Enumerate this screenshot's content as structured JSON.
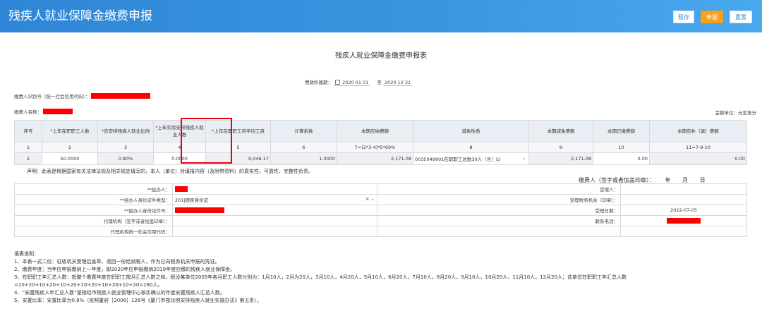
{
  "header": {
    "title": "残疾人就业保障金缴费申报",
    "buttons": {
      "save": "暂存",
      "submit": "申报",
      "reset": "重置"
    }
  },
  "form": {
    "title": "残疾人就业保障金缴费申报表",
    "period_label": "费款所属期：",
    "period_start": "2020 01 01",
    "period_to": "至",
    "period_end": "2020 12 31",
    "payer_id_label": "缴费人识别号（统一社会信用代码）：",
    "payer_name_label": "缴费人名称：",
    "unit_label": "金额单位：元至角分"
  },
  "table": {
    "headers": [
      {
        "star": "",
        "text": "序号"
      },
      {
        "star": "*",
        "text": "上年在职职工人数"
      },
      {
        "star": "*",
        "text": "应安排残疾人就业比例"
      },
      {
        "star": "*",
        "text": "上年实际安排残疾人就业人数"
      },
      {
        "star": "*",
        "text": "上年在职职工月平均工资"
      },
      {
        "star": "",
        "text": "计算系数"
      },
      {
        "star": "",
        "text": "本期应纳费额"
      },
      {
        "star": "",
        "text": "减免性质"
      },
      {
        "star": "",
        "text": "本期减免费额"
      },
      {
        "star": "",
        "text": "本期已缴费额"
      },
      {
        "star": "",
        "text": "本期应补（退）费额"
      }
    ],
    "col_numbers": [
      "1",
      "2",
      "3",
      "4",
      "5",
      "6",
      "7=(2*3-4)*5*60%",
      "8",
      "9",
      "10",
      "11=7-9-10"
    ],
    "row": {
      "seq": "2",
      "workers": "50.0000",
      "ratio": "0.80%",
      "actual_disabled": "0.0000",
      "avg_salary": "9,046.17",
      "coefficient": "1.0000",
      "payable": "2,171.08",
      "exemption": "0035049901在职职工总数30人（含）以",
      "exempt_amount": "2,171.08",
      "paid": "0.00",
      "refund": "0.00"
    }
  },
  "declaration": "声明：此表是根据国家有关法律法规及相关规定填写的，本人（单位）对填报内容（及附带资料）的真实性、可靠性、完整性负责。",
  "seal": {
    "label": "缴费人（签字或者加盖印章）：",
    "year": "年",
    "month": "月",
    "day": "日"
  },
  "info": {
    "handler_label": "*经办人：",
    "id_type_label": "*经办人身份证件类型：",
    "id_type_value": "201|居民身份证",
    "id_number_label": "*经办人身份证件号：",
    "agency_label": "代理机构（签字或者加盖印章）：",
    "agency_code_label": "代理机构统一社会信用代码：",
    "receiver_label": "受理人：",
    "tax_office_label": "受理税务机关（印章）：",
    "accept_date_label": "受理日期：",
    "accept_date": "2022-07-05",
    "phone_label": "联系电话："
  },
  "notes": [
    "填表说明：",
    "1、本表一式二份：征收机关受理后盖章，退回一份给纳税人，作为已向税务机关申报的凭证。",
    "2、缴费年度：当年应申报缴纳上一年度，即2020年应申报缴纳2019年度应缴的残疾人就业保障金。",
    "3、在职职工年汇总人数：指整个缴费年度在职职工按月汇总人数之和。假设某单位2005年各月职工人数分别为：1月10人，2月为20人，3月10人，4月20人，5月10人，6月20人，7月10人，8月20人，9月10人，10月20人，11月10人，12月20人；该单位在职职工年汇总人数",
    "=10+20+10+20+10+20+10+20+10+20+10+20=180人。",
    "4、“安置残疾人年汇总人数”是指经市残疾人就业管理中心核实确认的年度安置残疾人汇总人数。",
    "5、安置比率：安置比率为0.8%（依照厦府［2006］126号《厦门市按比例安排残疾人就业实施办法》第五条）。"
  ],
  "colors": {
    "topbar": "#3a95e0",
    "submit": "#f7a21c",
    "redaction": "#ff0000",
    "highlight": "#e60012"
  },
  "icons": [
    "calendar-icon",
    "clear-icon",
    "chevron-down-icon"
  ]
}
